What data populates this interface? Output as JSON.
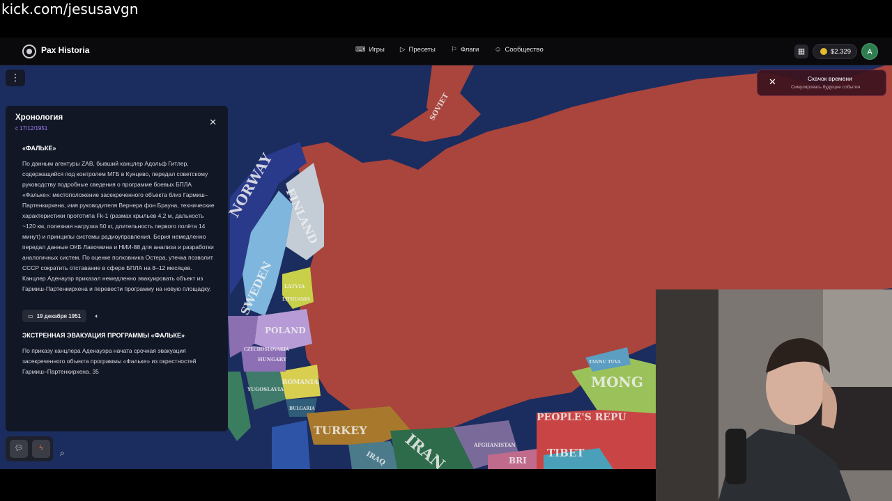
{
  "stream": {
    "url": "kick.com/jesusavgn"
  },
  "app": {
    "brand": "Pax Historia",
    "nav": [
      {
        "label": "Игры",
        "icon": "gamepad-icon"
      },
      {
        "label": "Пресеты",
        "icon": "play-icon"
      },
      {
        "label": "Флаги",
        "icon": "flag-icon"
      },
      {
        "label": "Сообщество",
        "icon": "users-icon"
      }
    ],
    "balance": "$2.329",
    "avatar_letter": "A"
  },
  "toast": {
    "title": "Скачок времени",
    "subtitle": "Симулировать будущие события"
  },
  "timeline": {
    "title": "Хронология",
    "since": "с 17/12/1951",
    "entry1_heading": "«ФАЛЬКЕ»",
    "entry1_text": "По данным агентуры ZAB, бывший канцлер Адольф Гитлер, содержащийся под контролем МГБ в Кунцево, передал советскому руководству подробные сведения о программе боевых БПЛА «Фальке»: местоположение засекреченного объекта близ Гармиш–Партенкирхена, имя руководителя Вернера фон Брауна, технические характеристики прототипа Fk-1 (размах крыльев 4,2 м, дальность ~120 км, полезная нагрузка 50 кг, длительность первого полёта 14 минут) и принципы системы радиоуправления. Берия немедленно передал данные ОКБ Лавочкина и НИИ-88 для анализа и разработки аналогичных систем. По оценке полковника Остера, утечка позволит СССР сократить отставание в сфере БПЛА на 8–12 месяцев. Канцлер Аденауэр приказал немедленно эвакуировать объект из Гармиш-Партенкирхена и перевести программу на новую площадку.",
    "entry2_date": "19 декабря 1951",
    "entry2_heading": "ЭКСТРЕННАЯ ЭВАКУАЦИЯ ПРОГРАММЫ «ФАЛЬКЕ»",
    "entry2_text": "По приказу канцлера Аденауэра начата срочная эвакуация засекреченного объекта программы «Фальке» из окрестностей Гармиш–Партенкирхена. 35"
  },
  "map": {
    "labels": [
      "SOVIET",
      "NORWAY",
      "FINLAND",
      "SWEDEN",
      "LATVIA",
      "LITHUANIA",
      "POLAND",
      "CZECHOSLOVAKIA",
      "HUNGARY",
      "ROMANIA",
      "YUGOSLAVIA",
      "BULGARIA",
      "TURKEY",
      "IRAQ",
      "IRAN",
      "AFGHANISTAN",
      "MONG",
      "PEOPLE'S REPU",
      "TIBET",
      "TANNU TUVA",
      "BRI"
    ]
  },
  "colors": {
    "ussr": "#a9453c",
    "ocean": "#1d2f63",
    "accent_purple": "#a07ef5",
    "toast_bg": "#3c121e"
  }
}
